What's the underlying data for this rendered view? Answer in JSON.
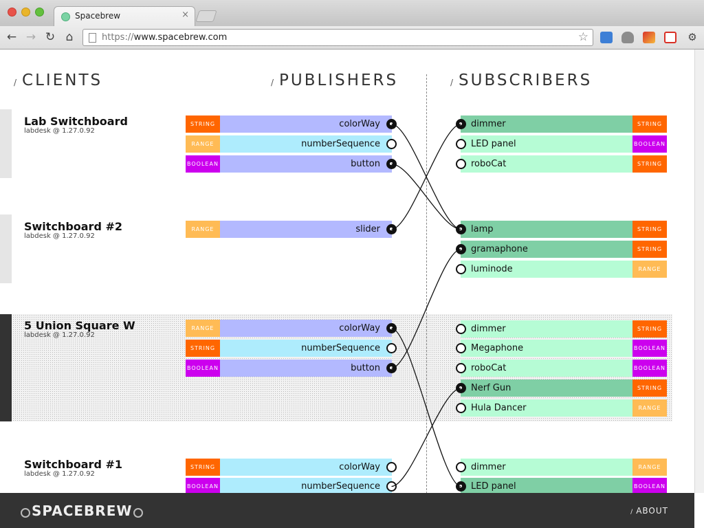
{
  "browser": {
    "tab_title": "Spacebrew",
    "tab_close": "×",
    "url_scheme": "https://",
    "url_host": "www.spacebrew.com"
  },
  "columns": {
    "clients": "CLIENTS",
    "publishers": "PUBLISHERS",
    "subscribers": "SUBSCRIBERS",
    "slash": "/"
  },
  "colors": {
    "string": "#ff6600",
    "range": "#ffbb55",
    "boolean": "#cc00ee",
    "pub_connected": "#b3b9ff",
    "pub_idle": "#aeecfd",
    "sub_connected": "#7fcfa5",
    "sub_idle": "#b6fcd5"
  },
  "clients": [
    {
      "name": "Lab Switchboard",
      "address": "labdesk @ 1.27.0.92",
      "selected": false
    },
    {
      "name": "Switchboard #2",
      "address": "labdesk @ 1.27.0.92",
      "selected": false
    },
    {
      "name": "5 Union Square W",
      "address": "labdesk @ 1.27.0.92",
      "selected": true
    },
    {
      "name": "Switchboard #1",
      "address": "labdesk @ 1.27.0.92",
      "selected": false
    }
  ],
  "publishers": [
    {
      "label": "colorWay",
      "type": "STRING",
      "connected": true
    },
    {
      "label": "numberSequence",
      "type": "RANGE",
      "connected": false
    },
    {
      "label": "button",
      "type": "BOOLEAN",
      "connected": true
    },
    {
      "label": "slider",
      "type": "RANGE",
      "connected": true
    },
    {
      "label": "colorWay",
      "type": "RANGE",
      "connected": true
    },
    {
      "label": "numberSequence",
      "type": "STRING",
      "connected": false
    },
    {
      "label": "button",
      "type": "BOOLEAN",
      "connected": true
    },
    {
      "label": "colorWay",
      "type": "STRING",
      "connected": false
    },
    {
      "label": "numberSequence",
      "type": "BOOLEAN",
      "connected": false
    }
  ],
  "subscribers": [
    {
      "label": "dimmer",
      "type": "STRING",
      "connected": true
    },
    {
      "label": "LED panel",
      "type": "BOOLEAN",
      "connected": false
    },
    {
      "label": "roboCat",
      "type": "STRING",
      "connected": false
    },
    {
      "label": "lamp",
      "type": "STRING",
      "connected": true
    },
    {
      "label": "gramaphone",
      "type": "STRING",
      "connected": true
    },
    {
      "label": "luminode",
      "type": "RANGE",
      "connected": false
    },
    {
      "label": "dimmer",
      "type": "STRING",
      "connected": false
    },
    {
      "label": "Megaphone",
      "type": "BOOLEAN",
      "connected": false
    },
    {
      "label": "roboCat",
      "type": "BOOLEAN",
      "connected": false
    },
    {
      "label": "Nerf Gun",
      "type": "STRING",
      "connected": true
    },
    {
      "label": "Hula Dancer",
      "type": "RANGE",
      "connected": false
    },
    {
      "label": "dimmer",
      "type": "RANGE",
      "connected": false
    },
    {
      "label": "LED panel",
      "type": "BOOLEAN",
      "connected": true
    }
  ],
  "routes": [
    {
      "from": 0,
      "to": 3
    },
    {
      "from": 2,
      "to": 3
    },
    {
      "from": 3,
      "to": 0
    },
    {
      "from": 4,
      "to": 12
    },
    {
      "from": 6,
      "to": 4
    },
    {
      "from": 8,
      "to": 9
    }
  ],
  "footer": {
    "logo": "SPACEBREW",
    "about": "ABOUT",
    "slash": "/"
  }
}
